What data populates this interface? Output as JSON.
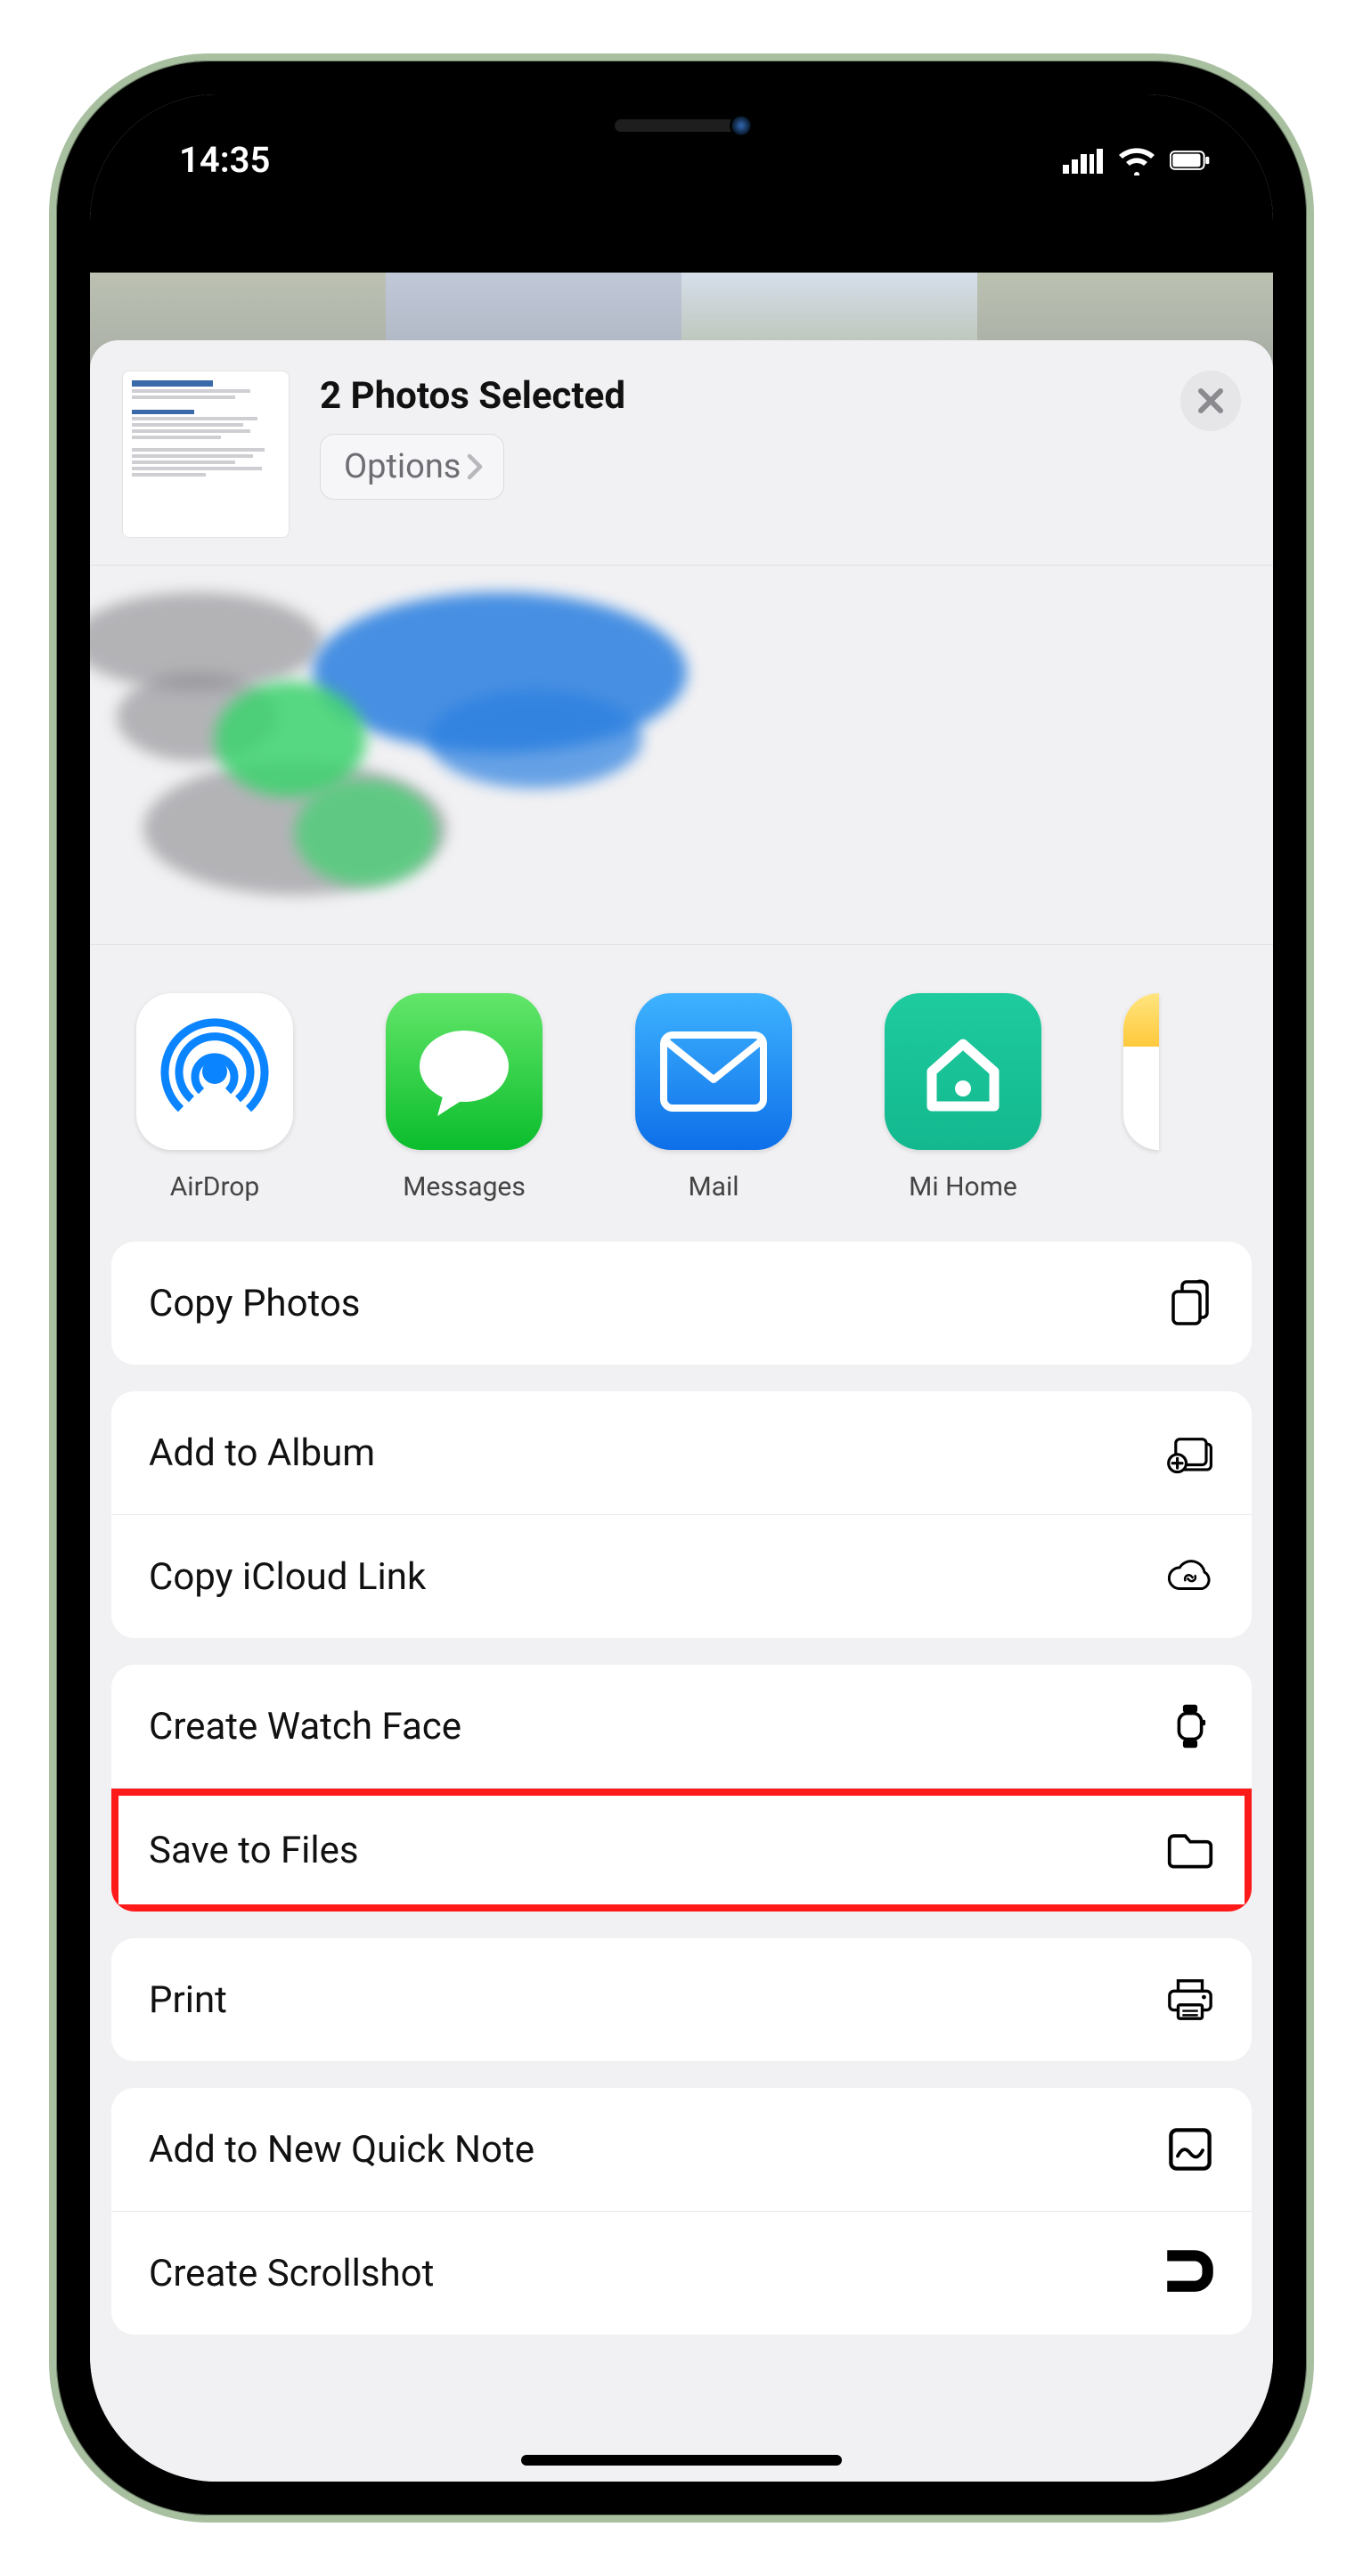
{
  "status": {
    "time": "14:35"
  },
  "header": {
    "title": "2 Photos Selected",
    "options_label": "Options"
  },
  "apps": [
    {
      "label": "AirDrop"
    },
    {
      "label": "Messages"
    },
    {
      "label": "Mail"
    },
    {
      "label": "Mi Home"
    },
    {
      "label": ""
    }
  ],
  "actions": {
    "copy_photos": "Copy Photos",
    "add_to_album": "Add to Album",
    "copy_icloud_link": "Copy iCloud Link",
    "create_watch_face": "Create Watch Face",
    "save_to_files": "Save to Files",
    "print": "Print",
    "add_quick_note": "Add to New Quick Note",
    "create_scrollshot": "Create Scrollshot"
  }
}
